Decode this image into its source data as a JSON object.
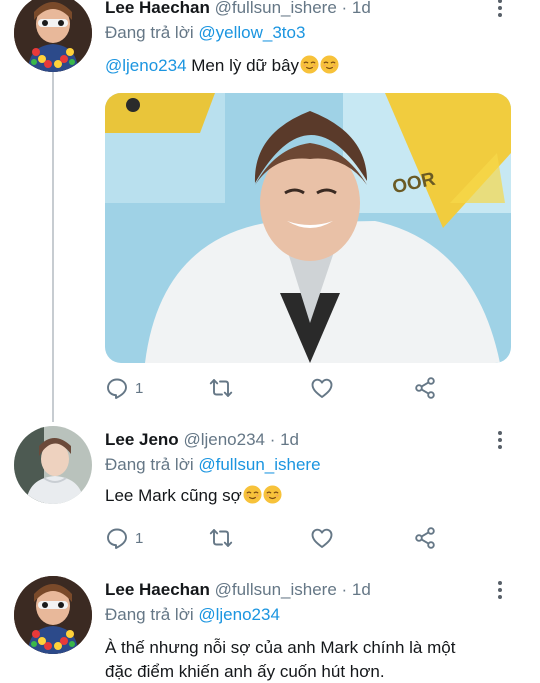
{
  "tweets": [
    {
      "name": "Lee Haechan",
      "handle": "@fullsun_ishere",
      "time": "· 1d",
      "reply_prefix": "Đang trả lời",
      "reply_to": "@yellow_3to3",
      "mention": "@ljeno234",
      "text": " Men lỳ dữ bây",
      "emojis": [
        "relieved-face-emoji",
        "relieved-face-emoji"
      ],
      "has_media": true,
      "reply_count": "1"
    },
    {
      "name": "Lee Jeno",
      "handle": "@ljeno234",
      "time": "· 1d",
      "reply_prefix": "Đang trả lời",
      "reply_to": "@fullsun_ishere",
      "text": "Lee Mark cũng sợ",
      "emojis": [
        "relieved-face-emoji",
        "relieved-face-emoji"
      ],
      "reply_count": "1"
    },
    {
      "name": "Lee Haechan",
      "handle": "@fullsun_ishere",
      "time": "· 1d",
      "reply_prefix": "Đang trả lời",
      "reply_to": "@ljeno234",
      "text_line1": "À thế nhưng nỗi sợ của anh Mark chính là một",
      "text_line2": "đặc điểm khiến anh ấy cuốn hút hơn."
    }
  ],
  "colors": {
    "link": "#1b95e0",
    "secondary_text": "#657786",
    "icon": "#657786",
    "thread_line": "#c7ccd1"
  },
  "icons": [
    "reply-icon",
    "retweet-icon",
    "like-icon",
    "share-icon",
    "more-options-icon"
  ]
}
